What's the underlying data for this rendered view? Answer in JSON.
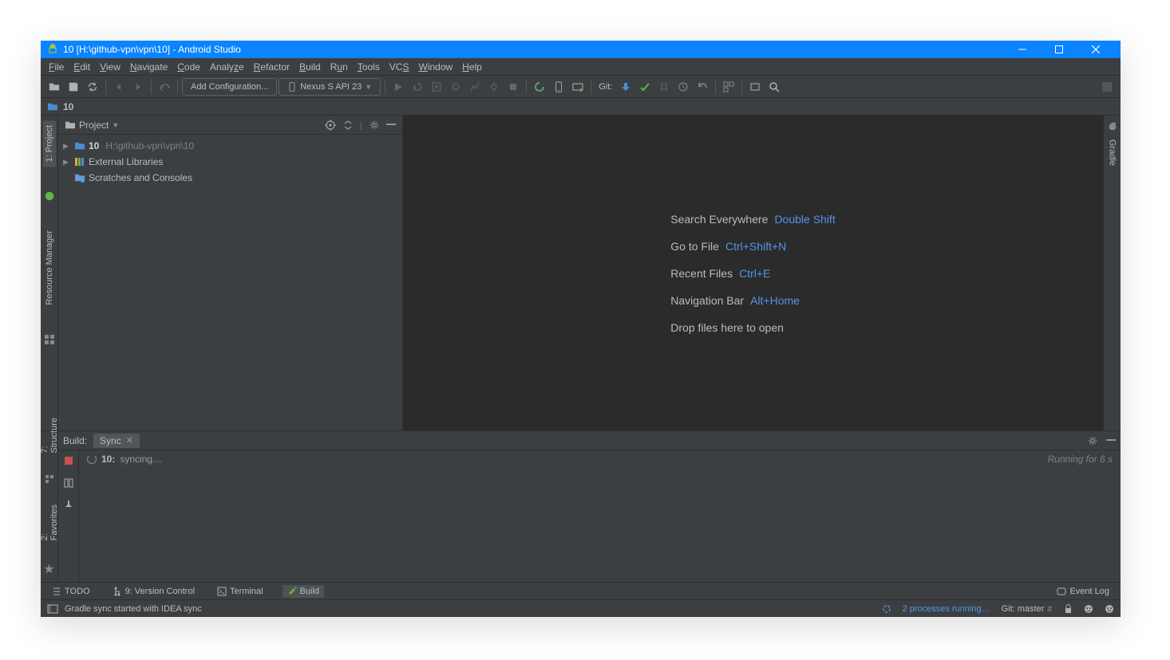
{
  "titlebar": {
    "title": "10 [H:\\github-vpn\\vpn\\10] - Android Studio"
  },
  "menubar": {
    "items": [
      "File",
      "Edit",
      "View",
      "Navigate",
      "Code",
      "Analyze",
      "Refactor",
      "Build",
      "Run",
      "Tools",
      "VCS",
      "Window",
      "Help"
    ]
  },
  "toolbar": {
    "add_configuration": "Add Configuration...",
    "device": "Nexus S API 23",
    "git_label": "Git:"
  },
  "breadcrumb": {
    "root": "10"
  },
  "project_panel": {
    "title": "Project",
    "tree": {
      "root_name": "10",
      "root_path": "H:\\github-vpn\\vpn\\10",
      "external_libs": "External Libraries",
      "scratches": "Scratches and Consoles"
    }
  },
  "left_tabs": {
    "project": "1: Project",
    "resource_manager": "Resource Manager"
  },
  "right_tabs": {
    "gradle": "Gradle"
  },
  "bottom_left_tabs": {
    "structure": "7: Structure",
    "favorites": "2: Favorites"
  },
  "editor_hints": {
    "search_label": "Search Everywhere",
    "search_shortcut": "Double Shift",
    "goto_label": "Go to File",
    "goto_shortcut": "Ctrl+Shift+N",
    "recent_label": "Recent Files",
    "recent_shortcut": "Ctrl+E",
    "nav_label": "Navigation Bar",
    "nav_shortcut": "Alt+Home",
    "drop_label": "Drop files here to open"
  },
  "build_panel": {
    "label": "Build:",
    "tab": "Sync",
    "project": "10:",
    "status": "syncing…",
    "running": "Running for 6 s"
  },
  "tool_windows": {
    "todo": "TODO",
    "version_control": "9: Version Control",
    "terminal": "Terminal",
    "build": "Build",
    "event_log": "Event Log"
  },
  "statusbar": {
    "message": "Gradle sync started with IDEA sync",
    "processes": "2 processes running…",
    "git": "Git: master"
  }
}
